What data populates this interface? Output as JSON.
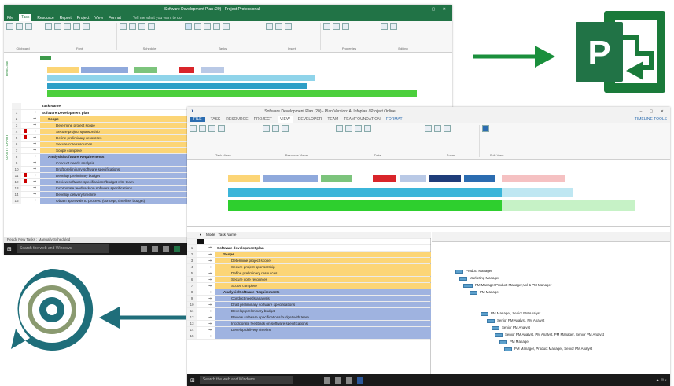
{
  "colors": {
    "project_green": "#217346",
    "arrow_teal": "#1f6e7a",
    "arrow_green": "#1a8f3c",
    "summary_yellow": "#fcd576",
    "summary_blue": "#9fb3e0",
    "taskbar": "#1a1a1a"
  },
  "win_a": {
    "title": "Software Development Plan (20) - Project Professional",
    "tabs": [
      "File",
      "Task",
      "Resource",
      "Report",
      "Project",
      "View",
      "Format"
    ],
    "active_tab": "Task",
    "tell_me": "Tell me what you want to do",
    "ribbon_groups": [
      "Clipboard",
      "Font",
      "Schedule",
      "Tasks",
      "Insert",
      "Properties",
      "Editing"
    ],
    "side_label": "TIMELINE",
    "grid_side_label": "GANTT CHART",
    "rows": [
      {
        "n": "",
        "name": "Task Name",
        "kind": "header"
      },
      {
        "n": "1",
        "name": "Software Development plan",
        "kind": "plain"
      },
      {
        "n": "2",
        "name": "Scope",
        "kind": "yellow-head"
      },
      {
        "n": "3",
        "name": "Determine project scope",
        "kind": "yellow"
      },
      {
        "n": "4",
        "name": "Secure project sponsorship",
        "kind": "yellow"
      },
      {
        "n": "5",
        "name": "Define preliminary resources",
        "kind": "yellow"
      },
      {
        "n": "6",
        "name": "Secure core resources",
        "kind": "yellow"
      },
      {
        "n": "7",
        "name": "Scope complete",
        "kind": "yellow"
      },
      {
        "n": "8",
        "name": "Analysis/Software Requirements",
        "kind": "blue-head"
      },
      {
        "n": "9",
        "name": "Conduct needs analysis",
        "kind": "blue"
      },
      {
        "n": "10",
        "name": "Draft preliminary software specifications",
        "kind": "blue"
      },
      {
        "n": "11",
        "name": "Develop preliminary budget",
        "kind": "blue"
      },
      {
        "n": "12",
        "name": "Review software specifications/budget with team",
        "kind": "blue"
      },
      {
        "n": "13",
        "name": "Incorporate feedback on software specifications",
        "kind": "blue"
      },
      {
        "n": "14",
        "name": "Develop delivery timeline",
        "kind": "blue"
      },
      {
        "n": "15",
        "name": "Obtain approvals to proceed (concept, timeline, budget)",
        "kind": "blue"
      }
    ],
    "status": "Ready    New Tasks : Manually Scheduled",
    "taskbar_search": "Search the web and Windows"
  },
  "win_b": {
    "title": "Software Development Plan (20) - Plan Version: Ai Infoplan / Project Online",
    "tabs": [
      "FILE",
      "TASK",
      "RESOURCE",
      "PROJECT",
      "VIEW",
      "DEVELOPER",
      "TEAM",
      "TEAMFOUNDATION",
      "FORMAT"
    ],
    "active_tab": "VIEW",
    "timeline_tools": "TIMELINE TOOLS",
    "ribbon_groups": [
      "Task Views",
      "Resource Views",
      "Data",
      "Zoom",
      "Split View"
    ],
    "grid_header": [
      "Task Name"
    ],
    "rows": [
      {
        "n": "1",
        "name": "Software development plan",
        "kind": "plain"
      },
      {
        "n": "2",
        "name": "Scope",
        "kind": "yellow-head"
      },
      {
        "n": "3",
        "name": "Determine project scope",
        "kind": "yellow"
      },
      {
        "n": "4",
        "name": "Secure project sponsorship",
        "kind": "yellow"
      },
      {
        "n": "5",
        "name": "Define preliminary resources",
        "kind": "yellow"
      },
      {
        "n": "6",
        "name": "Secure core resources",
        "kind": "yellow"
      },
      {
        "n": "7",
        "name": "Scope complete",
        "kind": "yellow"
      },
      {
        "n": "8",
        "name": "Analysis/Software Requirements",
        "kind": "blue-head"
      },
      {
        "n": "9",
        "name": "Conduct needs analysis",
        "kind": "blue"
      },
      {
        "n": "10",
        "name": "Draft preliminary software specifications",
        "kind": "blue"
      },
      {
        "n": "11",
        "name": "Develop preliminary budget",
        "kind": "blue"
      },
      {
        "n": "12",
        "name": "Review software specifications/budget with team",
        "kind": "blue"
      },
      {
        "n": "13",
        "name": "Incorporate feedback on software specifications",
        "kind": "blue"
      },
      {
        "n": "14",
        "name": "Develop delivery timeline",
        "kind": "blue"
      },
      {
        "n": "15",
        "name": "",
        "kind": "blue"
      }
    ],
    "gantt_labels": [
      "Product Manager",
      "Marketing Manager",
      "PM Manager,Product Manager,Vol & PM Manager",
      "PM Manager",
      "PM Manager, Senior PM Analyst",
      "Senior PM Analyst, PM Analyst",
      "Senior PM Analyst",
      "Senior PM Analyst, PM Analyst, PM Manager, Senior PM Analyst",
      "PM Manager",
      "PM Manager, Product Manager, Senior PM Analyst"
    ],
    "taskbar_search": "Search the web and Windows"
  }
}
